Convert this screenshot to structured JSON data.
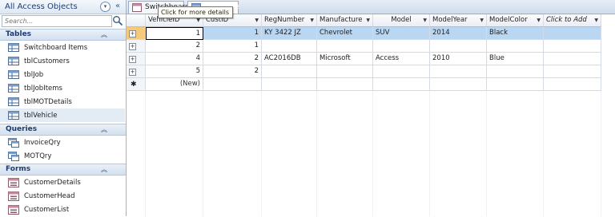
{
  "nav": {
    "title": "All Access Objects",
    "search_placeholder": "Search...",
    "groups": [
      {
        "label": "Tables",
        "items": [
          "Switchboard Items",
          "tblCustomers",
          "tblJob",
          "tblJobItems",
          "tblMOTDetails",
          "tblVehicle"
        ],
        "selected": "tblVehicle"
      },
      {
        "label": "Queries",
        "items": [
          "InvoiceQry",
          "MOTQry"
        ]
      },
      {
        "label": "Forms",
        "items": [
          "CustomerDetails",
          "CustomerHead",
          "CustomerList"
        ]
      }
    ]
  },
  "tabs": [
    {
      "label": "Switchboard",
      "active": false
    },
    {
      "label": "tblVehicle",
      "active": true
    }
  ],
  "tooltip": "Click for more details",
  "datasheet": {
    "columns": [
      "VehicleID",
      "CustID",
      "RegNumber",
      "Manufacture",
      "Model",
      "ModelYear",
      "ModelColor",
      "Click to Add"
    ],
    "rows": [
      [
        "1",
        "1",
        "KY 3422 JZ",
        "Chevrolet",
        "SUV",
        "2014",
        "Black"
      ],
      [
        "2",
        "1",
        "",
        "",
        "",
        "",
        ""
      ],
      [
        "4",
        "2",
        "AC2016DB",
        "Microsoft",
        "Access",
        "2010",
        "Blue"
      ],
      [
        "5",
        "2",
        "",
        "",
        "",
        "",
        ""
      ]
    ],
    "new_row_label": "(New)"
  },
  "colors": {
    "accent": "#1e3c6e",
    "selected_row": "#b9d7f3",
    "selector_active": "#f7c97a"
  }
}
